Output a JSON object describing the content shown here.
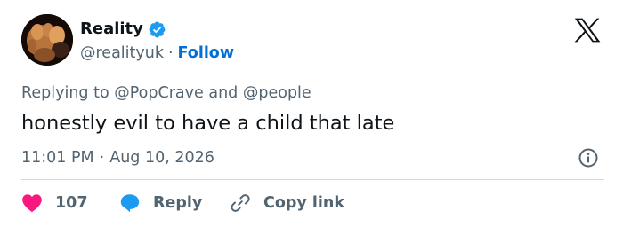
{
  "account": {
    "display_name": "Reality",
    "handle": "@realityuk",
    "separator": "·",
    "follow_label": "Follow",
    "verified_color": "#1d9bf0"
  },
  "reply_context": {
    "prefix": "Replying to",
    "mention_1": "@PopCrave",
    "conjunction": "and",
    "mention_2": "@people"
  },
  "tweet": {
    "text": "honestly evil to have a child that late"
  },
  "meta": {
    "time": "11:01 PM",
    "separator": "·",
    "date": "Aug 10, 2026"
  },
  "actions": {
    "like_count": "107",
    "reply_label": "Reply",
    "copy_label": "Copy link"
  },
  "icons": {
    "brand": "x-logo-icon",
    "info": "info-icon",
    "like": "heart-icon",
    "reply": "speech-bubble-icon",
    "copy": "link-icon",
    "verified": "verified-badge-icon"
  },
  "colors": {
    "heart": "#f91880",
    "reply_bubble": "#1d9bf0",
    "follow": "#006fd6",
    "muted_text": "#536471",
    "primary_text": "#0f1419"
  }
}
